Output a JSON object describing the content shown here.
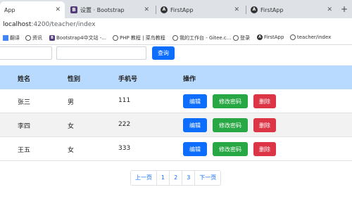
{
  "browser": {
    "tabs": [
      {
        "label": "App",
        "icon": "tab-icon",
        "active": true
      },
      {
        "label": "设置 · Bootstrap",
        "icon": "bootstrap-icon"
      },
      {
        "label": "FirstApp",
        "icon": "angular-icon"
      },
      {
        "label": "FirstApp",
        "icon": "angular-icon"
      }
    ],
    "url_host": "localhost",
    "url_path": ":4200/teacher/index",
    "bookmarks": [
      {
        "label": "翻译",
        "icon": "grid-icon"
      },
      {
        "label": "资讯",
        "icon": "globe-icon"
      },
      {
        "label": "Bootstrap4中文站 -...",
        "icon": "bootstrap-icon"
      },
      {
        "label": "PHP 教程 | 菜鸟教程",
        "icon": "globe-icon"
      },
      {
        "label": "我的工作台 - Gitee.c...",
        "icon": "globe-icon"
      },
      {
        "label": "登录",
        "icon": "globe-icon"
      },
      {
        "label": "FirstApp",
        "icon": "angular-icon"
      },
      {
        "label": "teacher/index",
        "icon": "globe-icon"
      }
    ]
  },
  "search": {
    "button_label": "查询",
    "name_value": "",
    "phone_value": ""
  },
  "table": {
    "headers": [
      "姓名",
      "性别",
      "手机号",
      "操作"
    ],
    "rows": [
      {
        "name": "张三",
        "gender": "男",
        "phone": "111"
      },
      {
        "name": "李四",
        "gender": "女",
        "phone": "222"
      },
      {
        "name": "王五",
        "gender": "女",
        "phone": "333"
      }
    ],
    "actions": {
      "edit": "编辑",
      "change_password": "修改密码",
      "delete": "删除"
    }
  },
  "pagination": {
    "prev": "上一页",
    "pages": [
      "1",
      "2",
      "3"
    ],
    "next": "下一页"
  },
  "colors": {
    "primary": "#0d6efd",
    "success": "#28a745",
    "danger": "#dc3545",
    "table_header": "#b9daff"
  }
}
